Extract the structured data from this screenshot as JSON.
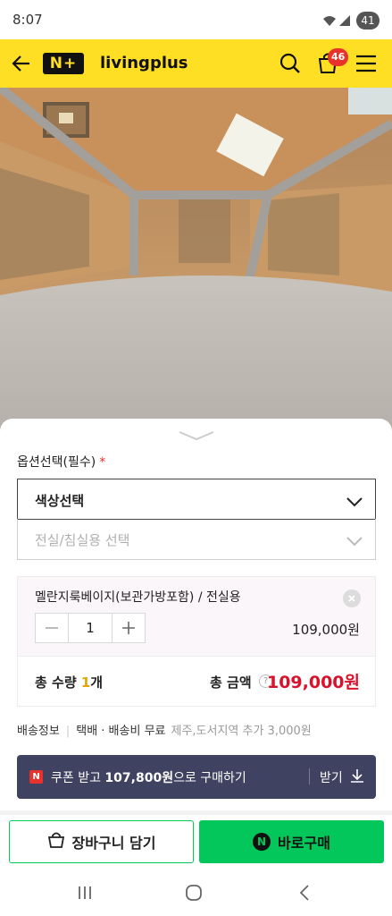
{
  "status_bar": {
    "time": "8:07",
    "battery": "41"
  },
  "header": {
    "logo_text": "N+",
    "brand": "livingplus",
    "cart_count": "46"
  },
  "sheet": {
    "option_label": "옵션선택(필수)",
    "required_mark": "*",
    "select_color": {
      "label": "색상선택"
    },
    "select_room": {
      "label": "전실/침실용 선택"
    },
    "selected_item": {
      "name": "멜란지룩베이지(보관가방포함) / 전실용",
      "quantity": "1",
      "price": "109,000원"
    },
    "total": {
      "qty_label": "총 수량",
      "qty_value": "1",
      "qty_unit": "개",
      "amount_label": "총 금액",
      "help": "?",
      "amount": "109,000원"
    },
    "shipping": {
      "label": "배송정보",
      "method": "택배 · 배송비 무료",
      "extra": "제주,도서지역 추가 3,000원"
    },
    "coupon": {
      "badge": "N",
      "text_pre": "쿠폰 받고 ",
      "text_amount": "107,800원",
      "text_post": "으로 구매하기",
      "get_label": "받기"
    }
  },
  "bottom_bar": {
    "cart_button": "장바구니 담기",
    "buy_mark": "N",
    "buy_button": "바로구매"
  },
  "colors": {
    "header_bg": "#ffdf23",
    "naver_green": "#03c75a",
    "price_red": "#d9122b",
    "coupon_bg": "#404261",
    "badge_red": "#e8322c"
  },
  "icons": [
    "wifi-icon",
    "signal-icon",
    "back-arrow-icon",
    "search-icon",
    "cart-icon",
    "menu-icon",
    "chevron-down-icon",
    "close-icon",
    "minus-icon",
    "plus-icon",
    "download-icon",
    "bag-icon",
    "recent-apps-icon",
    "home-icon",
    "back-nav-icon"
  ]
}
